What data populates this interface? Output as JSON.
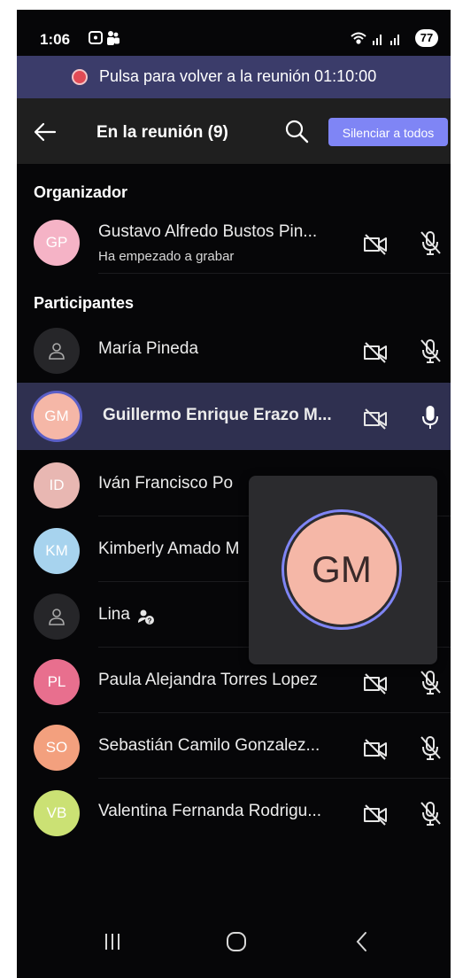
{
  "status_bar": {
    "time": "1:06",
    "battery": "77",
    "icons_left": [
      "screenshot-icon",
      "teams-icon"
    ],
    "icons_right": [
      "wifi-icon",
      "signal-icon",
      "signal-icon"
    ]
  },
  "banner": {
    "text": "Pulsa para volver a la reunión 01:10:00",
    "dot_color": "#e14b55"
  },
  "header": {
    "title": "En la reunión (9)",
    "mute_all_label": "Silenciar a todos",
    "accent": "#7f85f5"
  },
  "sections": {
    "organizer": "Organizador",
    "participants": "Participantes"
  },
  "organizer": {
    "initials": "GP",
    "name": "Gustavo Alfredo Bustos Pin...",
    "status": "Ha empezado a grabar",
    "color": "#f5b3c6"
  },
  "participants": [
    {
      "initials": "",
      "name": "María Pineda",
      "avatar": "person-icon",
      "mic": "muted"
    },
    {
      "initials": "GM",
      "name": "Guillermo Enrique Erazo M...",
      "color": "#f5b7a7",
      "mic": "active",
      "speaking": true
    },
    {
      "initials": "ID",
      "name": "Iván Francisco Po",
      "color": "#e8b7b2"
    },
    {
      "initials": "KM",
      "name": "Kimberly Amado M",
      "color": "#a7d3ee"
    },
    {
      "initials": "",
      "name": "Lina",
      "avatar": "person-icon",
      "badge": "guest-icon"
    },
    {
      "initials": "PL",
      "name": "Paula Alejandra Torres Lopez",
      "color": "#e86f8e",
      "mic": "muted"
    },
    {
      "initials": "SO",
      "name": "Sebastián Camilo Gonzalez...",
      "color": "#f3a07e",
      "mic": "muted"
    },
    {
      "initials": "VB",
      "name": "Valentina Fernanda Rodrigu...",
      "color": "#cbe174",
      "mic": "muted"
    }
  ],
  "popup": {
    "initials": "GM"
  },
  "nav": [
    "recent-apps-icon",
    "home-icon",
    "back-nav-icon"
  ]
}
